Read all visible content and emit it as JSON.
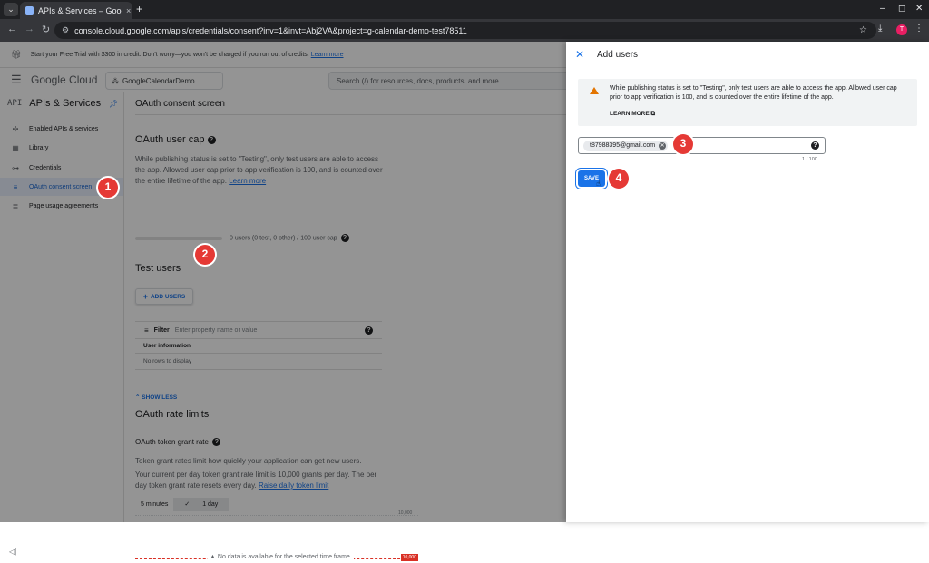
{
  "browser": {
    "tab_title": "APIs & Services – Google",
    "tab_close": "×",
    "new_tab": "+",
    "url": "console.cloud.google.com/apis/credentials/consent?inv=1&invt=Abj2VA&project=g-calendar-demo-test78511",
    "profile_initial": "T",
    "window_controls": [
      "–",
      "◻",
      "✕"
    ]
  },
  "banner": {
    "text": "Start your Free Trial with $300 in credit. Don't worry—you won't be charged if you run out of credits.",
    "link": "Learn more"
  },
  "header": {
    "logo": "Google Cloud",
    "project": "GoogleCalendarDemo",
    "search_placeholder": "Search (/) for resources, docs, products, and more"
  },
  "sidebar": {
    "service_icon": "API",
    "service_title": "APIs & Services",
    "items": [
      {
        "label": "Enabled APIs & services",
        "icon": "✣"
      },
      {
        "label": "Library",
        "icon": "▦"
      },
      {
        "label": "Credentials",
        "icon": "⊶"
      },
      {
        "label": "OAuth consent screen",
        "icon": "≡"
      },
      {
        "label": "Page usage agreements",
        "icon": "≣"
      }
    ],
    "collapse": "◁|"
  },
  "main": {
    "page_title": "OAuth consent screen",
    "cap_title": "OAuth user cap",
    "cap_text": "While publishing status is set to \"Testing\", only test users are able to access the app. Allowed user cap prior to app verification is 100, and is counted over the entire lifetime of the app.",
    "cap_link": "Learn more",
    "cap_stat": "0 users (0 test, 0 other) / 100 user cap",
    "cap_fraction": 0.0,
    "test_users_title": "Test users",
    "add_users_label": "ADD USERS",
    "filter_label": "Filter",
    "filter_placeholder": "Enter property name or value",
    "column_header": "User information",
    "no_rows": "No rows to display",
    "show_less": "SHOW LESS",
    "rate_title": "OAuth rate limits",
    "grant_rate_title": "OAuth token grant rate",
    "grant_text_1": "Token grant rates limit how quickly your application can get new users.",
    "grant_text_2": "Your current per day token grant rate limit is 10,000 grants per day. The per day token grant rate resets every day.",
    "grant_link": "Raise daily token limit",
    "chip_5min": "5 minutes",
    "chip_1day": "1 day",
    "chart_max": "10,000",
    "no_data": "No data is available for the selected time frame.",
    "limit_flag": "10,000"
  },
  "panel": {
    "title": "Add users",
    "warning": "While publishing status is set to \"Testing\", only test users are able to access the app. Allowed user cap prior to app verification is 100, and is counted over the entire lifetime of the app.",
    "learn_more": "LEARN MORE",
    "email_chip": "t87988395@gmail.com",
    "counter": "1 / 100",
    "save_label": "SAVE"
  },
  "steps": [
    "1",
    "2",
    "3",
    "4"
  ]
}
